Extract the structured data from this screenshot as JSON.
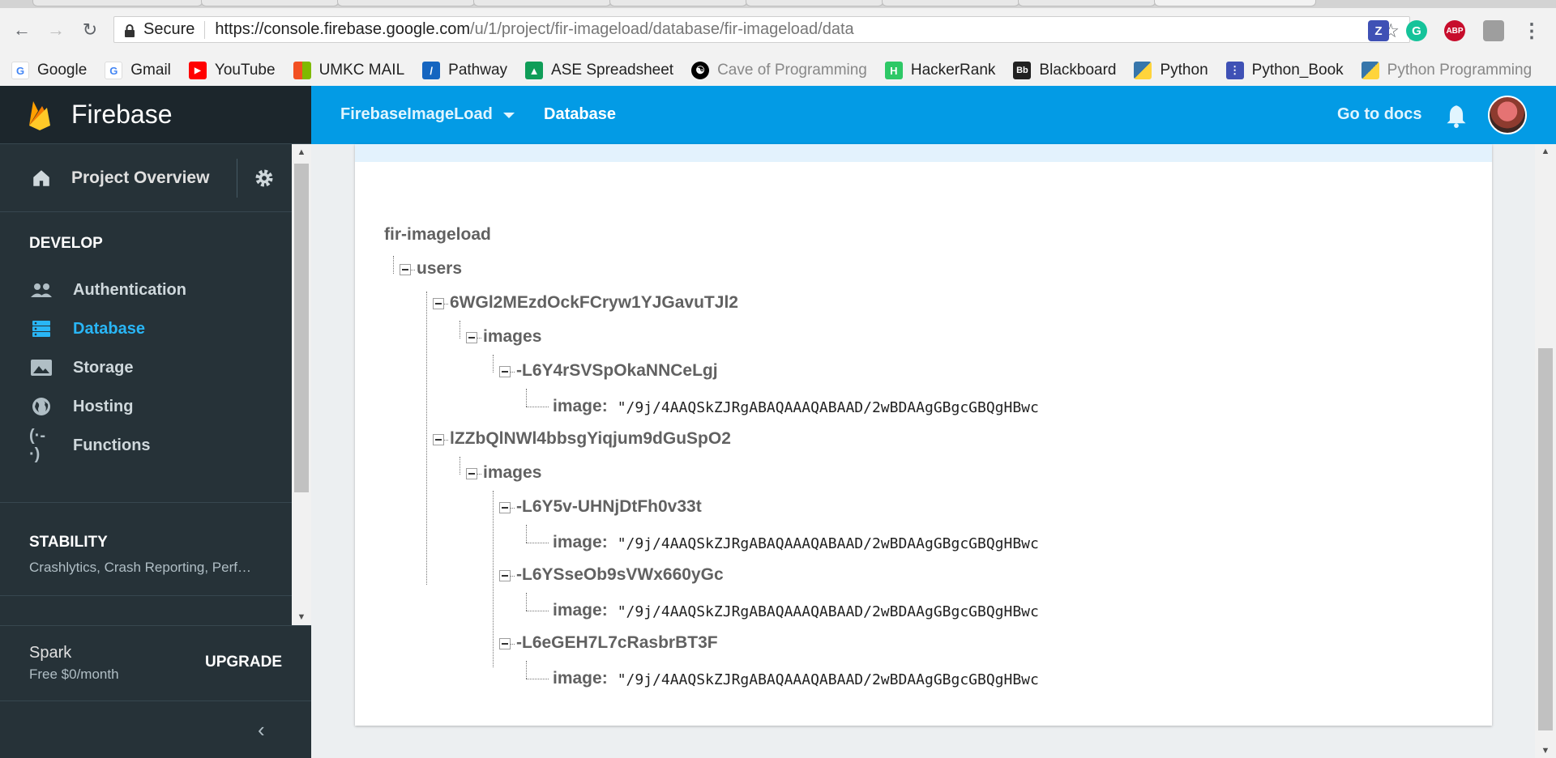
{
  "browser": {
    "secure_label": "Secure",
    "url_host": "https://console.firebase.google.com",
    "url_path": "/u/1/project/fir-imageload/database/fir-imageload/data",
    "extensions": [
      {
        "label": "Z",
        "color": "#3f51b5"
      },
      {
        "label": "G",
        "color": "#15c39a"
      },
      {
        "label": "ABP",
        "color": "#c70d2c"
      },
      {
        "label": "",
        "color": "#9e9e9e"
      }
    ],
    "bookmarks": [
      {
        "label": "Google",
        "icon": "google-icon",
        "color": "#4285f4"
      },
      {
        "label": "Gmail",
        "icon": "google-icon",
        "color": "#4285f4"
      },
      {
        "label": "YouTube",
        "icon": "youtube-icon",
        "color": "#ff0000"
      },
      {
        "label": "UMKC MAIL",
        "icon": "windows-icon",
        "color": "#f25022"
      },
      {
        "label": "Pathway",
        "icon": "pathway-icon",
        "color": "#1565c0"
      },
      {
        "label": "ASE Spreadsheet",
        "icon": "drive-icon",
        "color": "#0f9d58"
      },
      {
        "label": "Cave of Programming",
        "icon": "yin-yang-icon",
        "color": "#000000"
      },
      {
        "label": "HackerRank",
        "icon": "hackerrank-icon",
        "color": "#2ec866"
      },
      {
        "label": "Blackboard",
        "icon": "blackboard-icon",
        "color": "#222222"
      },
      {
        "label": "Python",
        "icon": "python-icon",
        "color": "#3776ab"
      },
      {
        "label": "Python_Book",
        "icon": "book-icon",
        "color": "#3f51b5"
      },
      {
        "label": "Python Programming",
        "icon": "python-icon",
        "color": "#3776ab"
      }
    ]
  },
  "sidebar": {
    "brand": "Firebase",
    "project_overview": "Project Overview",
    "develop_title": "DEVELOP",
    "items": [
      {
        "label": "Authentication",
        "icon": "people-icon"
      },
      {
        "label": "Database",
        "icon": "database-icon"
      },
      {
        "label": "Storage",
        "icon": "image-icon"
      },
      {
        "label": "Hosting",
        "icon": "globe-icon"
      },
      {
        "label": "Functions",
        "icon": "functions-icon"
      }
    ],
    "stability_title": "STABILITY",
    "stability_sub": "Crashlytics, Crash Reporting, Perf…",
    "plan_name": "Spark",
    "plan_price": "Free $0/month",
    "upgrade": "UPGRADE"
  },
  "header": {
    "project": "FirebaseImageLoad",
    "page": "Database",
    "docs": "Go to docs"
  },
  "tree": {
    "root": "fir-imageload",
    "users": "users",
    "user1": "6WGl2MEzdOckFCryw1YJGavuTJl2",
    "user1_images": "images",
    "user1_img1": "-L6Y4rSVSpOkaNNCeLgj",
    "user2": "lZZbQlNWl4bbsgYiqjum9dGuSpO2",
    "user2_images": "images",
    "user2_img1": "-L6Y5v-UHNjDtFh0v33t",
    "user2_img2": "-L6YSseOb9sVWx660yGc",
    "user2_img3": "-L6eGEH7L7cRasbrBT3F",
    "image_key": "image:",
    "image_value": "\"/9j/4AAQSkZJRgABAQAAAQABAAD/2wBDAAgGBgcGBQgHBwc"
  }
}
